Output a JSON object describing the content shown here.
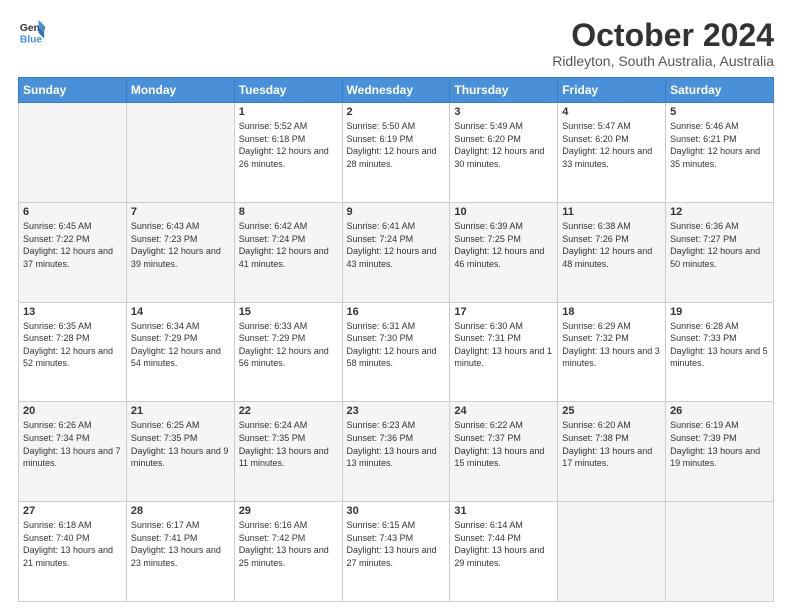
{
  "logo": {
    "line1": "General",
    "line2": "Blue"
  },
  "title": "October 2024",
  "location": "Ridleyton, South Australia, Australia",
  "days_of_week": [
    "Sunday",
    "Monday",
    "Tuesday",
    "Wednesday",
    "Thursday",
    "Friday",
    "Saturday"
  ],
  "weeks": [
    [
      {
        "day": "",
        "sunrise": "",
        "sunset": "",
        "daylight": ""
      },
      {
        "day": "",
        "sunrise": "",
        "sunset": "",
        "daylight": ""
      },
      {
        "day": "1",
        "sunrise": "Sunrise: 5:52 AM",
        "sunset": "Sunset: 6:18 PM",
        "daylight": "Daylight: 12 hours and 26 minutes."
      },
      {
        "day": "2",
        "sunrise": "Sunrise: 5:50 AM",
        "sunset": "Sunset: 6:19 PM",
        "daylight": "Daylight: 12 hours and 28 minutes."
      },
      {
        "day": "3",
        "sunrise": "Sunrise: 5:49 AM",
        "sunset": "Sunset: 6:20 PM",
        "daylight": "Daylight: 12 hours and 30 minutes."
      },
      {
        "day": "4",
        "sunrise": "Sunrise: 5:47 AM",
        "sunset": "Sunset: 6:20 PM",
        "daylight": "Daylight: 12 hours and 33 minutes."
      },
      {
        "day": "5",
        "sunrise": "Sunrise: 5:46 AM",
        "sunset": "Sunset: 6:21 PM",
        "daylight": "Daylight: 12 hours and 35 minutes."
      }
    ],
    [
      {
        "day": "6",
        "sunrise": "Sunrise: 6:45 AM",
        "sunset": "Sunset: 7:22 PM",
        "daylight": "Daylight: 12 hours and 37 minutes."
      },
      {
        "day": "7",
        "sunrise": "Sunrise: 6:43 AM",
        "sunset": "Sunset: 7:23 PM",
        "daylight": "Daylight: 12 hours and 39 minutes."
      },
      {
        "day": "8",
        "sunrise": "Sunrise: 6:42 AM",
        "sunset": "Sunset: 7:24 PM",
        "daylight": "Daylight: 12 hours and 41 minutes."
      },
      {
        "day": "9",
        "sunrise": "Sunrise: 6:41 AM",
        "sunset": "Sunset: 7:24 PM",
        "daylight": "Daylight: 12 hours and 43 minutes."
      },
      {
        "day": "10",
        "sunrise": "Sunrise: 6:39 AM",
        "sunset": "Sunset: 7:25 PM",
        "daylight": "Daylight: 12 hours and 46 minutes."
      },
      {
        "day": "11",
        "sunrise": "Sunrise: 6:38 AM",
        "sunset": "Sunset: 7:26 PM",
        "daylight": "Daylight: 12 hours and 48 minutes."
      },
      {
        "day": "12",
        "sunrise": "Sunrise: 6:36 AM",
        "sunset": "Sunset: 7:27 PM",
        "daylight": "Daylight: 12 hours and 50 minutes."
      }
    ],
    [
      {
        "day": "13",
        "sunrise": "Sunrise: 6:35 AM",
        "sunset": "Sunset: 7:28 PM",
        "daylight": "Daylight: 12 hours and 52 minutes."
      },
      {
        "day": "14",
        "sunrise": "Sunrise: 6:34 AM",
        "sunset": "Sunset: 7:29 PM",
        "daylight": "Daylight: 12 hours and 54 minutes."
      },
      {
        "day": "15",
        "sunrise": "Sunrise: 6:33 AM",
        "sunset": "Sunset: 7:29 PM",
        "daylight": "Daylight: 12 hours and 56 minutes."
      },
      {
        "day": "16",
        "sunrise": "Sunrise: 6:31 AM",
        "sunset": "Sunset: 7:30 PM",
        "daylight": "Daylight: 12 hours and 58 minutes."
      },
      {
        "day": "17",
        "sunrise": "Sunrise: 6:30 AM",
        "sunset": "Sunset: 7:31 PM",
        "daylight": "Daylight: 13 hours and 1 minute."
      },
      {
        "day": "18",
        "sunrise": "Sunrise: 6:29 AM",
        "sunset": "Sunset: 7:32 PM",
        "daylight": "Daylight: 13 hours and 3 minutes."
      },
      {
        "day": "19",
        "sunrise": "Sunrise: 6:28 AM",
        "sunset": "Sunset: 7:33 PM",
        "daylight": "Daylight: 13 hours and 5 minutes."
      }
    ],
    [
      {
        "day": "20",
        "sunrise": "Sunrise: 6:26 AM",
        "sunset": "Sunset: 7:34 PM",
        "daylight": "Daylight: 13 hours and 7 minutes."
      },
      {
        "day": "21",
        "sunrise": "Sunrise: 6:25 AM",
        "sunset": "Sunset: 7:35 PM",
        "daylight": "Daylight: 13 hours and 9 minutes."
      },
      {
        "day": "22",
        "sunrise": "Sunrise: 6:24 AM",
        "sunset": "Sunset: 7:35 PM",
        "daylight": "Daylight: 13 hours and 11 minutes."
      },
      {
        "day": "23",
        "sunrise": "Sunrise: 6:23 AM",
        "sunset": "Sunset: 7:36 PM",
        "daylight": "Daylight: 13 hours and 13 minutes."
      },
      {
        "day": "24",
        "sunrise": "Sunrise: 6:22 AM",
        "sunset": "Sunset: 7:37 PM",
        "daylight": "Daylight: 13 hours and 15 minutes."
      },
      {
        "day": "25",
        "sunrise": "Sunrise: 6:20 AM",
        "sunset": "Sunset: 7:38 PM",
        "daylight": "Daylight: 13 hours and 17 minutes."
      },
      {
        "day": "26",
        "sunrise": "Sunrise: 6:19 AM",
        "sunset": "Sunset: 7:39 PM",
        "daylight": "Daylight: 13 hours and 19 minutes."
      }
    ],
    [
      {
        "day": "27",
        "sunrise": "Sunrise: 6:18 AM",
        "sunset": "Sunset: 7:40 PM",
        "daylight": "Daylight: 13 hours and 21 minutes."
      },
      {
        "day": "28",
        "sunrise": "Sunrise: 6:17 AM",
        "sunset": "Sunset: 7:41 PM",
        "daylight": "Daylight: 13 hours and 23 minutes."
      },
      {
        "day": "29",
        "sunrise": "Sunrise: 6:16 AM",
        "sunset": "Sunset: 7:42 PM",
        "daylight": "Daylight: 13 hours and 25 minutes."
      },
      {
        "day": "30",
        "sunrise": "Sunrise: 6:15 AM",
        "sunset": "Sunset: 7:43 PM",
        "daylight": "Daylight: 13 hours and 27 minutes."
      },
      {
        "day": "31",
        "sunrise": "Sunrise: 6:14 AM",
        "sunset": "Sunset: 7:44 PM",
        "daylight": "Daylight: 13 hours and 29 minutes."
      },
      {
        "day": "",
        "sunrise": "",
        "sunset": "",
        "daylight": ""
      },
      {
        "day": "",
        "sunrise": "",
        "sunset": "",
        "daylight": ""
      }
    ]
  ]
}
